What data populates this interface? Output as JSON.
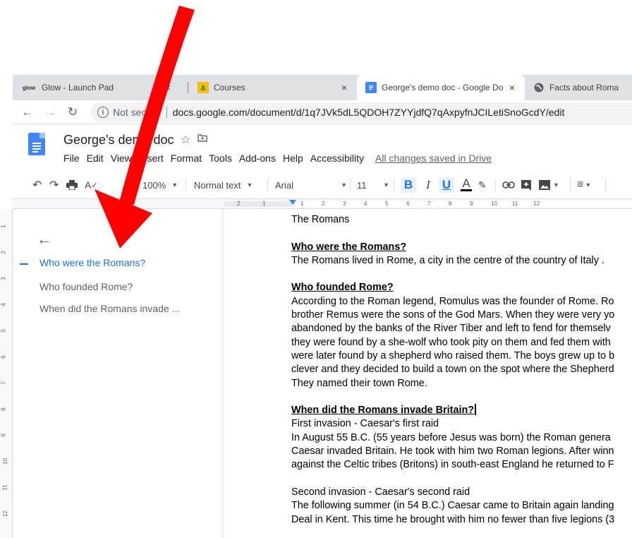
{
  "browser": {
    "tabs": [
      {
        "title": "Glow - Launch Pad",
        "favicon": "glow-icon",
        "active": false
      },
      {
        "title": "Courses",
        "favicon": "courses-icon",
        "active": false
      },
      {
        "title": "George's demo doc - Google Do",
        "favicon": "docs-icon",
        "active": true
      },
      {
        "title": "Facts about Roma",
        "favicon": "globe-icon",
        "active": false
      }
    ],
    "close_glyph": "×",
    "favicon_glow_text": "glow",
    "not_secure": "Not secure",
    "url": "docs.google.com/document/d/1q7JVk5dL5QDOH7ZYYjdfQ7qAxpyfnJCILetiSnoGcdY/edit"
  },
  "docs": {
    "title": "George's demo doc",
    "menu": [
      "File",
      "Edit",
      "View",
      "Insert",
      "Format",
      "Tools",
      "Add-ons",
      "Help",
      "Accessibility"
    ],
    "saved_status": "All changes saved in Drive",
    "toolbar": {
      "zoom": "100%",
      "style": "Normal text",
      "font": "Arial",
      "font_size": "11",
      "bold": "B",
      "italic": "I",
      "underline": "U",
      "text_color": "A"
    },
    "ruler_numbers": [
      "2",
      "1",
      "1",
      "2",
      "3",
      "4",
      "5",
      "6",
      "7",
      "8",
      "9",
      "10",
      "11",
      "12"
    ],
    "vruler_numbers": [
      "1",
      "2",
      "3",
      "4",
      "5",
      "6",
      "7",
      "8",
      "9",
      "10",
      "11",
      "12"
    ]
  },
  "outline": {
    "items": [
      {
        "label": "Who were the Romans?",
        "active": true
      },
      {
        "label": "Who founded Rome?",
        "active": false
      },
      {
        "label": "When did the Romans invade ...",
        "active": false
      }
    ]
  },
  "document": {
    "lines": [
      {
        "text": "The Romans",
        "type": "text"
      },
      {
        "text": "",
        "type": "gap"
      },
      {
        "text": "Who were the Romans?",
        "type": "head"
      },
      {
        "text": "The Romans lived in Rome, a city in the centre of the country of Italy .",
        "type": "text"
      },
      {
        "text": "",
        "type": "gap"
      },
      {
        "text": "Who founded Rome?",
        "type": "head"
      },
      {
        "text": "According to the Roman legend, Romulus was the founder of Rome. Ro",
        "type": "text"
      },
      {
        "text": "brother Remus were the sons of the God Mars. When they were very yo",
        "type": "text"
      },
      {
        "text": "abandoned by the banks of the River Tiber and left to fend for themselv",
        "type": "text"
      },
      {
        "text": "they were found by a she-wolf who took pity on them and fed them with",
        "type": "text"
      },
      {
        "text": "were later found by a shepherd who raised them. The boys grew up to b",
        "type": "text"
      },
      {
        "text": "clever and they decided to build a town on the spot where the Shepherd",
        "type": "text"
      },
      {
        "text": "They named their town Rome.",
        "type": "text"
      },
      {
        "text": "",
        "type": "gap"
      },
      {
        "text": "When did the Romans invade Britain?",
        "type": "head",
        "cursor": true
      },
      {
        "text": "First invasion - Caesar's first raid",
        "type": "text"
      },
      {
        "text": "In August 55 B.C. (55 years before Jesus was born) the Roman genera",
        "type": "text"
      },
      {
        "text": "Caesar invaded Britain. He took with him two Roman legions. After winn",
        "type": "text"
      },
      {
        "text": "against the Celtic tribes (Britons) in south-east England he returned to F",
        "type": "text"
      },
      {
        "text": "",
        "type": "gap"
      },
      {
        "text": "Second invasion - Caesar's second raid",
        "type": "text"
      },
      {
        "text": "The following summer (in 54 B.C.) Caesar came to Britain again landing",
        "type": "text"
      },
      {
        "text": "Deal in Kent. This time he brought with him no fewer than five legions (3",
        "type": "text"
      }
    ]
  },
  "colors": {
    "accent": "#1a73e8",
    "arrow": "#ff0000",
    "docs_blue": "#4285f4",
    "courses_yellow": "#fbbc04"
  }
}
